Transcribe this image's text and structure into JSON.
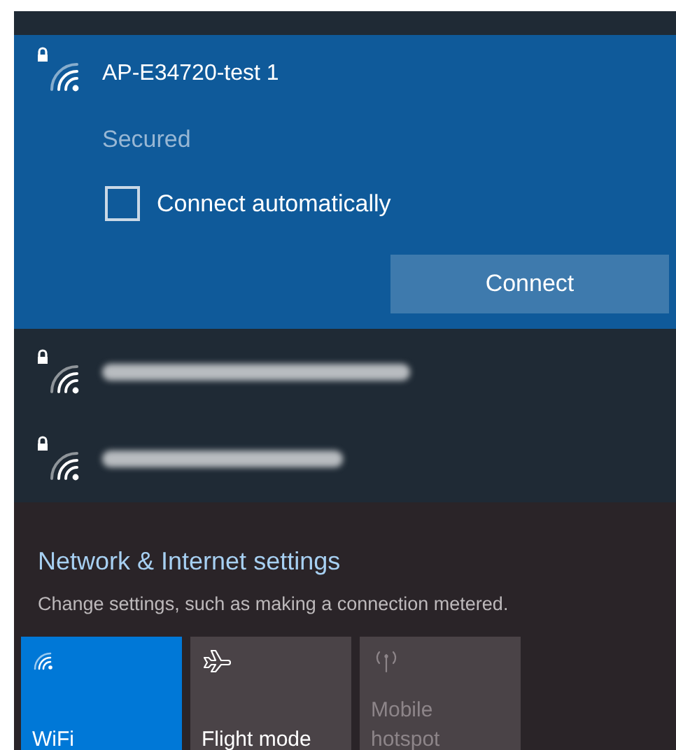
{
  "selected_network": {
    "name": "AP-E34720-test 1",
    "secured": true,
    "status": "Secured",
    "connect_automatically": {
      "label": "Connect automatically",
      "checked": false
    },
    "connect_button": "Connect"
  },
  "other_networks": [
    {
      "secured": true
    },
    {
      "secured": true
    }
  ],
  "settings_link": {
    "title": "Network & Internet settings",
    "subtitle": "Change settings, such as making a connection metered."
  },
  "quick_actions": [
    {
      "kind": "wifi",
      "label": "WiFi",
      "on": true,
      "disabled": false
    },
    {
      "kind": "flight",
      "label": "Flight mode",
      "on": false,
      "disabled": false
    },
    {
      "kind": "hotspot",
      "label": "Mobile hotspot",
      "on": false,
      "disabled": true
    }
  ]
}
